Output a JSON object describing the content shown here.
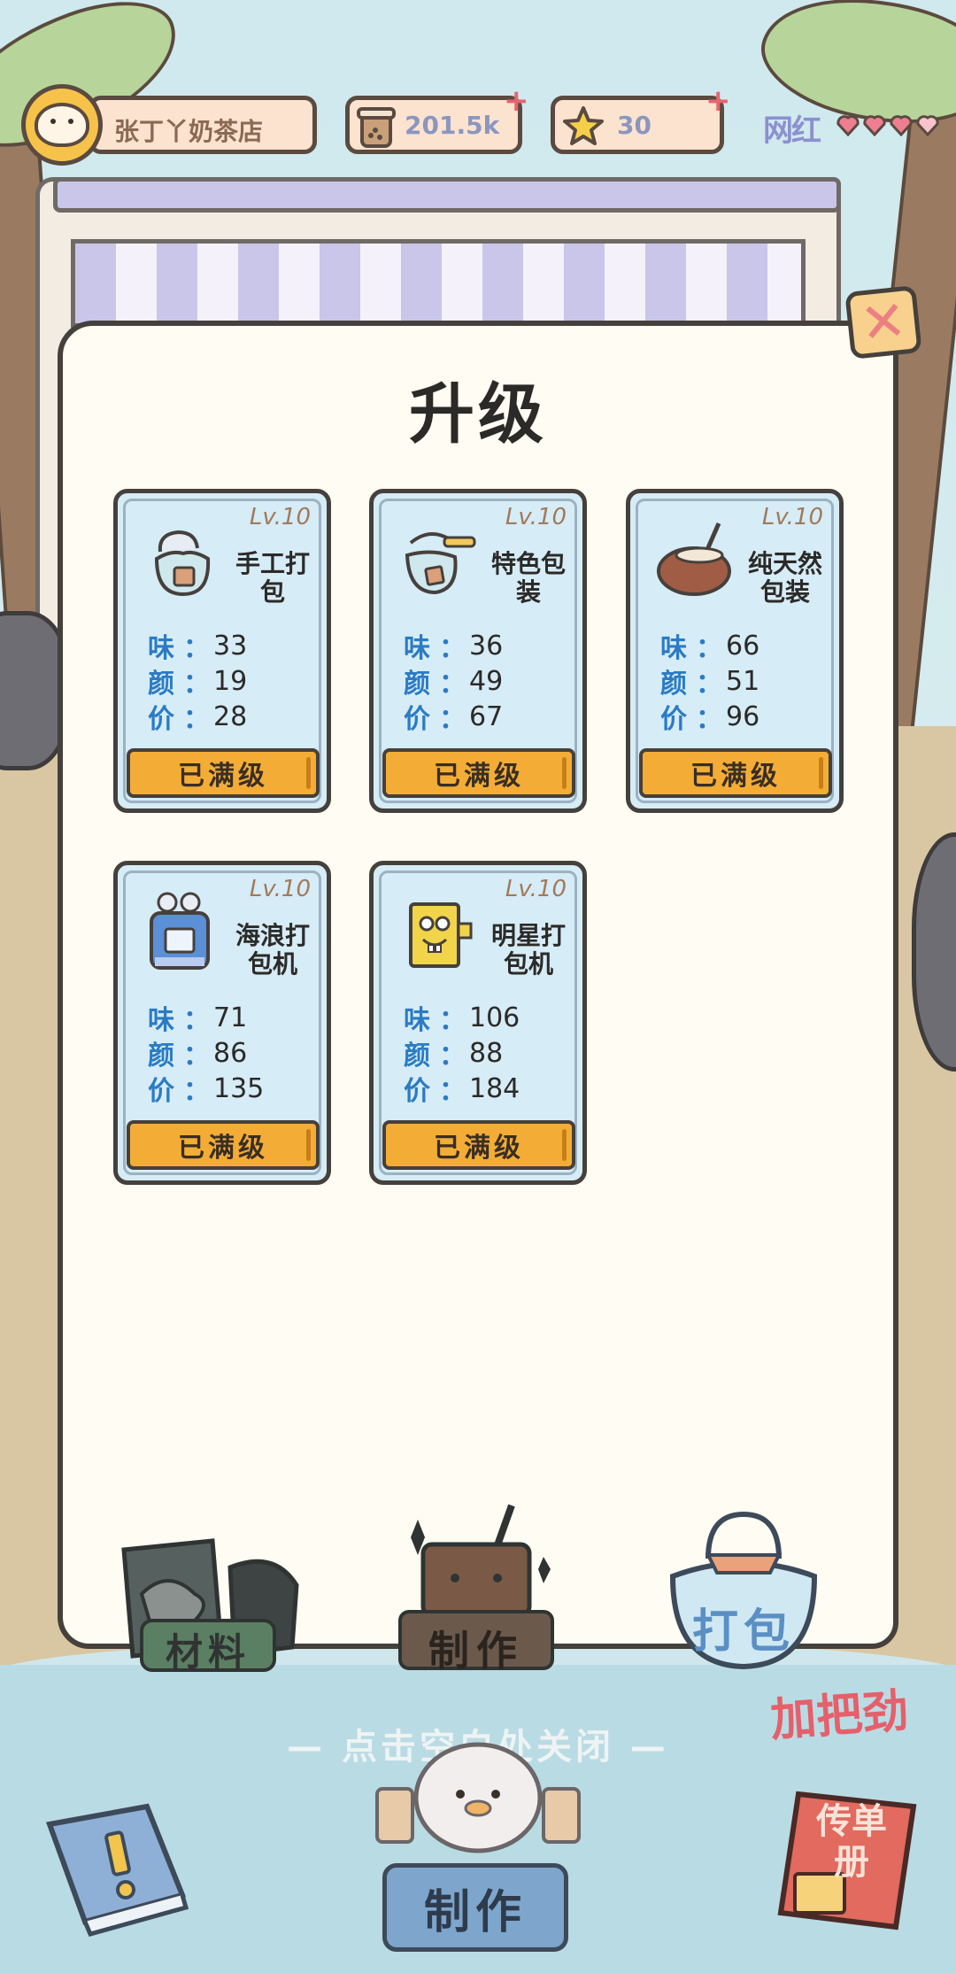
{
  "header": {
    "shop_name": "张丁丫奶茶店",
    "tea_count": "201.5k",
    "star_count": "30",
    "popularity_label": "网红"
  },
  "modal": {
    "title": "升级",
    "cards": [
      {
        "level": "Lv.10",
        "name_line1": "手工打",
        "name_line2": "包",
        "taste_label": "味",
        "look_label": "颜",
        "price_label": "价",
        "colon": "：",
        "taste": "33",
        "look": "19",
        "price": "28",
        "button": "已满级",
        "icon": "handmade-bag-icon"
      },
      {
        "level": "Lv.10",
        "name_line1": "特色包",
        "name_line2": "装",
        "taste_label": "味",
        "look_label": "颜",
        "price_label": "价",
        "colon": "：",
        "taste": "36",
        "look": "49",
        "price": "67",
        "button": "已满级",
        "icon": "special-package-icon"
      },
      {
        "level": "Lv.10",
        "name_line1": "纯天然",
        "name_line2": "包装",
        "taste_label": "味",
        "look_label": "颜",
        "price_label": "价",
        "colon": "：",
        "taste": "66",
        "look": "51",
        "price": "96",
        "button": "已满级",
        "icon": "coconut-icon"
      },
      {
        "level": "Lv.10",
        "name_line1": "海浪打",
        "name_line2": "包机",
        "taste_label": "味",
        "look_label": "颜",
        "price_label": "价",
        "colon": "：",
        "taste": "71",
        "look": "86",
        "price": "135",
        "button": "已满级",
        "icon": "wave-packer-icon"
      },
      {
        "level": "Lv.10",
        "name_line1": "明星打",
        "name_line2": "包机",
        "taste_label": "味",
        "look_label": "颜",
        "price_label": "价",
        "colon": "：",
        "taste": "106",
        "look": "88",
        "price": "184",
        "button": "已满级",
        "icon": "star-packer-icon"
      }
    ],
    "tabs": [
      {
        "label": "材料"
      },
      {
        "label": "制作"
      },
      {
        "label": "打包"
      }
    ]
  },
  "overlay": {
    "hint": "— 点击空白处关闭 —",
    "cheer": "加把劲"
  },
  "bottom_bar": {
    "make_label": "制作",
    "flyer_label_line1": "传单",
    "flyer_label_line2": "册"
  },
  "colors": {
    "card_bg": "#d6ecf6",
    "maxed_button": "#f3ad37",
    "stat_label": "#2b7bc4",
    "modal_bg": "#fffdf3"
  }
}
